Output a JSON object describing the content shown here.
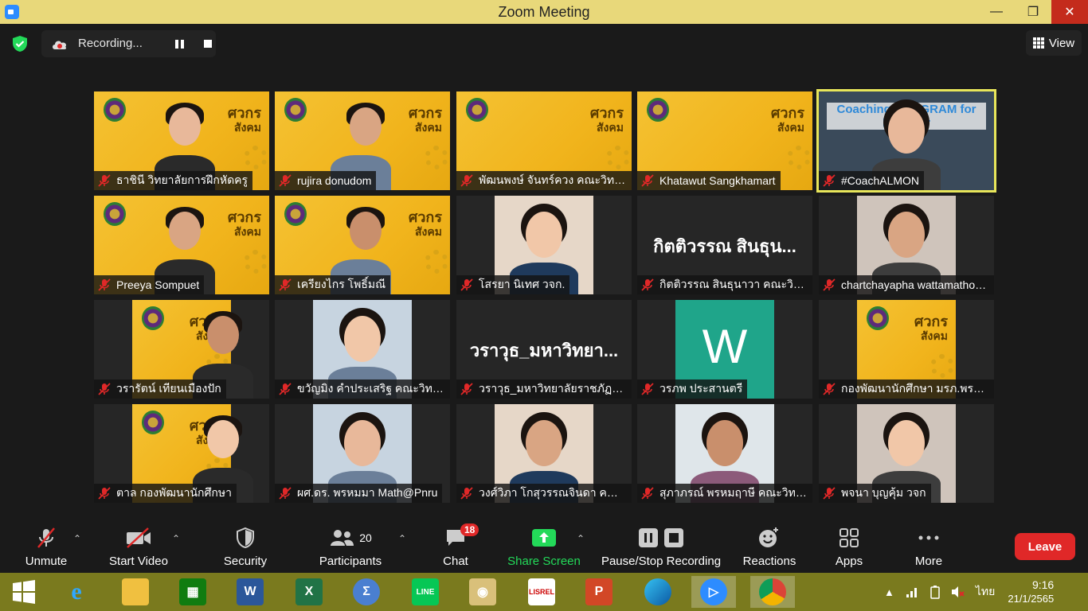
{
  "window": {
    "title": "Zoom Meeting"
  },
  "recording": {
    "label": "Recording..."
  },
  "view_button": {
    "label": "View"
  },
  "tiles": [
    {
      "name": "ธาชินี  วิทยาลัยการฝึกหัดครู",
      "kind": "poster"
    },
    {
      "name": "rujira donudom",
      "kind": "poster"
    },
    {
      "name": "พัฒนพงษ์ จันทร์ควง คณะวิทยาศาส...",
      "kind": "poster"
    },
    {
      "name": "Khatawut Sangkhamart",
      "kind": "poster"
    },
    {
      "name": "#CoachALMON",
      "kind": "video",
      "overlay": "Coaching PROGRAM for Lecturer",
      "active": true
    },
    {
      "name": "Preeya Sompuet",
      "kind": "poster"
    },
    {
      "name": "เครียงไกร โพธิ์มณี",
      "kind": "poster"
    },
    {
      "name": "โสรยา นิเทศ วจก.",
      "kind": "video"
    },
    {
      "name": "กิตติวรรณ สินธุนาวา คณะวิทยาศาสต...",
      "kind": "text",
      "display": "กิตติวรรณ สินธุน..."
    },
    {
      "name": "chartchayapha wattamathorn...",
      "kind": "video"
    },
    {
      "name": "วรารัตน์ เทียนเมืองปัก",
      "kind": "poster"
    },
    {
      "name": "ขวัญมิง คำประเสริฐ คณะวิทยาศาสต...",
      "kind": "video"
    },
    {
      "name": "วราวุธ_มหาวิทยาลัยราชภัฏพระนคร...",
      "kind": "text",
      "display": "วราวุธ_มหาวิทยา..."
    },
    {
      "name": "วรภพ ประสานตรี",
      "kind": "avatar",
      "display": "W"
    },
    {
      "name": "กองพัฒนานักศึกษา มรภ.พระนคร",
      "kind": "poster"
    },
    {
      "name": "ตาล กองพัฒนานักศึกษา",
      "kind": "poster"
    },
    {
      "name": "ผศ.ดร. พรหมมา Math@Pnru",
      "kind": "video"
    },
    {
      "name": "วงศ์วิภา โกสุวรรณจินดา คณะวิทยาศ...",
      "kind": "video"
    },
    {
      "name": "สุภาภรณ์ พรหมฤาษี คณะวิทยาศาสต...",
      "kind": "video"
    },
    {
      "name": "พจนา บุญคุ้ม วจก",
      "kind": "video"
    }
  ],
  "poster_brand": {
    "line1": "ศวกร",
    "line2": "สังคม"
  },
  "toolbar": {
    "unmute": "Unmute",
    "start_video": "Start Video",
    "security": "Security",
    "participants": "Participants",
    "participants_count": "20",
    "chat": "Chat",
    "chat_badge": "18",
    "share_screen": "Share Screen",
    "pause_stop_recording": "Pause/Stop Recording",
    "reactions": "Reactions",
    "apps": "Apps",
    "more": "More",
    "leave": "Leave"
  },
  "taskbar": {
    "apps": [
      "Start",
      "Internet Explorer",
      "File Explorer",
      "Microsoft Store",
      "Word",
      "Excel",
      "Calculator",
      "LINE",
      "Paint",
      "LISREL",
      "PowerPoint",
      "Edge",
      "Zoom",
      "Chrome"
    ],
    "language": "ไทย",
    "time": "9:16",
    "date": "21/1/2565"
  },
  "colors": {
    "accent_green": "#23d959",
    "leave_red": "#e02828",
    "active_border": "#e8e65a",
    "taskbar": "#7a7a1e"
  }
}
